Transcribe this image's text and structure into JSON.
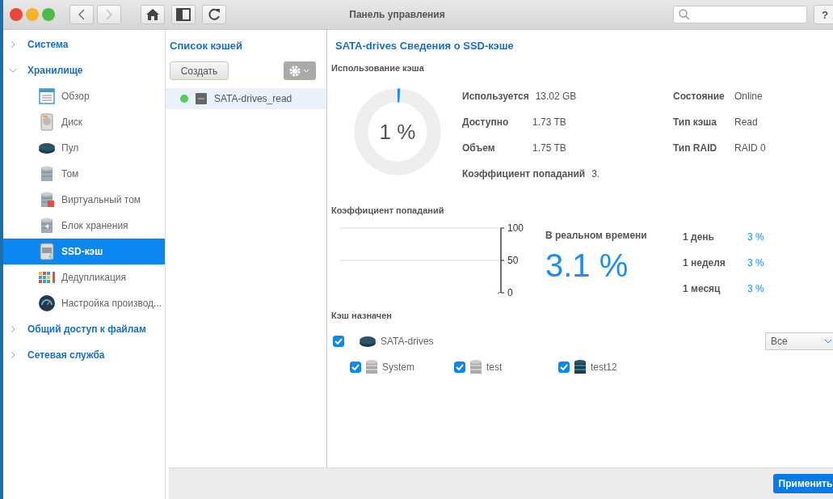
{
  "window": {
    "title": "Панель управления",
    "nav": [
      {
        "kind": "back",
        "disabled": false
      },
      {
        "kind": "forward",
        "disabled": true
      }
    ],
    "help": "?"
  },
  "sidebar": [
    {
      "label": "Система",
      "expanded": false
    },
    {
      "label": "Хранилище",
      "expanded": true,
      "children": [
        {
          "label": "Обзор",
          "kind": "overview",
          "selected": false
        },
        {
          "label": "Диск",
          "kind": "disk",
          "selected": false
        },
        {
          "label": "Пул",
          "kind": "pool",
          "selected": false
        },
        {
          "label": "Том",
          "kind": "volume",
          "selected": false
        },
        {
          "label": "Виртуальный том",
          "kind": "virtual",
          "selected": false
        },
        {
          "label": "Блок хранения",
          "kind": "block",
          "selected": false
        },
        {
          "label": "SSD-кэш",
          "kind": "ssd",
          "selected": true
        },
        {
          "label": "Дедупликация",
          "kind": "dedup",
          "selected": false
        },
        {
          "label": "Настройка производ...",
          "kind": "gauge",
          "selected": false
        }
      ]
    },
    {
      "label": "Общий доступ к файлам",
      "expanded": false
    },
    {
      "label": "Сетевая служба",
      "expanded": false
    }
  ],
  "cache_list": {
    "title": "Список кэшей",
    "create_button": "Создать",
    "items": [
      {
        "name": "SATA-drives_read",
        "color": "#55cc55",
        "selected": true
      }
    ]
  },
  "details": {
    "title": "SATA-drives Сведения о SSD-кэше",
    "usage": {
      "heading": "Использование кэша",
      "level": 0.01,
      "percent": "1 %",
      "left": [
        {
          "label": "Используется",
          "value": "13.02 GB"
        },
        {
          "label": "Доступно",
          "value": "1.73 TB"
        },
        {
          "label": "Объем",
          "value": "1.75 TB"
        },
        {
          "label": "Коэффициент попаданий",
          "value": "3."
        }
      ],
      "right": [
        {
          "label": "Состояние",
          "value": "Online"
        },
        {
          "label": "Тип кэша",
          "value": "Read"
        },
        {
          "label": "Тип RAID",
          "value": "RAID 0"
        }
      ]
    },
    "hit_rate": {
      "heading": "Коэффициент попаданий",
      "axis_labels": [
        "100",
        "50",
        "0"
      ],
      "realtime_label": "В реальном времени",
      "realtime_value": "3.1 %",
      "periods": [
        {
          "label": "1 день",
          "value": "3 %"
        },
        {
          "label": "1 неделя",
          "value": "3 %"
        },
        {
          "label": "1 месяц",
          "value": "3 %"
        }
      ]
    },
    "assigned": {
      "heading": "Кэш назначен",
      "pool": {
        "name": "SATA-drives",
        "checked": true
      },
      "filter": "Все",
      "volumes": [
        {
          "name": "System",
          "kind": "volume",
          "checked": true
        },
        {
          "name": "test",
          "kind": "volume",
          "checked": true
        },
        {
          "name": "test12",
          "kind": "dark",
          "checked": true
        }
      ]
    }
  },
  "apply_button": "Применить"
}
